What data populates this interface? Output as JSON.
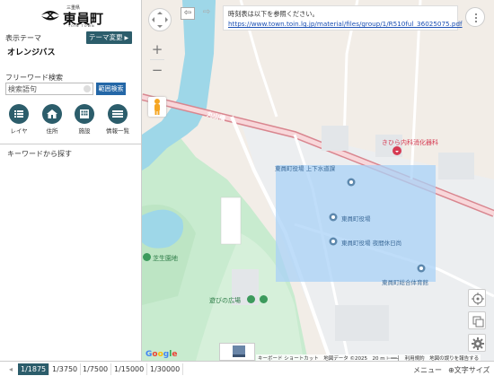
{
  "header": {
    "logo_sub": "三重県",
    "logo_main": "東員町",
    "logo_roman": "TOIN TOWN"
  },
  "sidebar": {
    "theme_label": "表示テーマ",
    "theme_name": "オレンジバス",
    "theme_change_label": "テーマ変更",
    "search_label": "フリーワード検索",
    "search_placeholder": "検索語句",
    "range_search_label": "範囲検索",
    "tools": [
      {
        "label": "レイヤ",
        "icon": "list-icon"
      },
      {
        "label": "住所",
        "icon": "house-icon"
      },
      {
        "label": "施設",
        "icon": "building-icon"
      },
      {
        "label": "情報一覧",
        "icon": "table-icon"
      }
    ],
    "keyword_link": "キーワードから探す"
  },
  "map": {
    "notice_text": "時刻表は以下を参照ください。",
    "notice_link": "https://www.town.toin.lg.jp/material/files/group/1/R510ful_36025075.pdf",
    "road_name": "丸山橋",
    "labels": {
      "hospital": "きひら内科消化器科",
      "sewer": "東員町役場 上下水道課",
      "town_hall": "東員町役場",
      "night_window": "東員町役場 夜間休日尚",
      "gym": "東員町総合体育館",
      "lawn_park": "芝生園地",
      "play_plaza": "遊びの広場"
    },
    "google": "Google",
    "attribution": "キーボード ショートカット　地図データ ©2025　20 m ⊢━━┤　利用規約　地図の誤りを報告する"
  },
  "bottom_bar": {
    "scales": [
      "1/1875",
      "1/3750",
      "1/7500",
      "1/15000",
      "1/30000"
    ],
    "active_scale": "1/1875",
    "menu_label": "メニュー",
    "text_size_label": "⊕文字サイズ"
  },
  "colors": {
    "primary": "#2c5d6b",
    "range_button": "#2467a7",
    "river": "#9ed7e8",
    "park": "#c9eccf",
    "overlay": "#a9d2f7",
    "hospital": "#d63b53"
  }
}
